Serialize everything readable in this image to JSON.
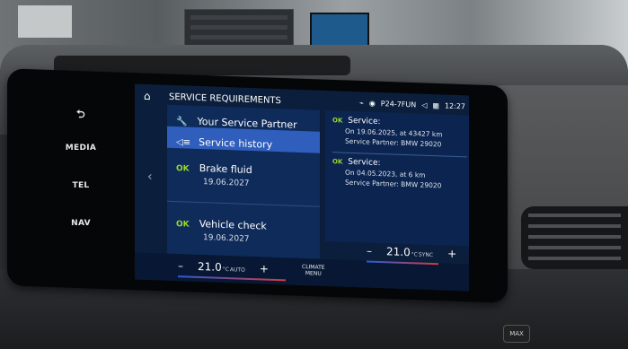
{
  "side_buttons": {
    "back_icon": "return-arrow-icon",
    "media": "MEDIA",
    "tel": "TEL",
    "nav": "NAV"
  },
  "header": {
    "title": "SERVICE REQUIREMENTS",
    "home_icon": "home-icon",
    "status": {
      "profile": "P24-7FUN",
      "time": "12:27"
    }
  },
  "left_list": {
    "partner": "Your Service Partner",
    "history": "Service history",
    "items": [
      {
        "ok": "OK",
        "title": "Brake fluid",
        "date": "19.06.2027"
      },
      {
        "ok": "OK",
        "title": "Vehicle check",
        "date": "19.06.2027"
      }
    ]
  },
  "history_entries": [
    {
      "ok": "OK",
      "title": "Service:",
      "line1": "On 19.06.2025, at 43427 km",
      "line2": "Service Partner: BMW 29020"
    },
    {
      "ok": "OK",
      "title": "Service:",
      "line1": "On 04.05.2023, at 6 km",
      "line2": "Service Partner: BMW 29020"
    }
  ],
  "climate": {
    "driver": {
      "minus": "–",
      "temp": "21.0",
      "unit": "°C",
      "mode": "AUTO",
      "plus": "+"
    },
    "passenger": {
      "minus": "–",
      "temp": "21.0",
      "unit": "°C",
      "mode": "SYNC",
      "plus": "+"
    },
    "menu_line1": "CLIMATE",
    "menu_line2": "MENU"
  },
  "console": {
    "max": "MAX"
  },
  "colors": {
    "ok_green": "#9ad92e",
    "highlight": "#2f5ebc",
    "screen_bg": "#0b1e3c"
  }
}
